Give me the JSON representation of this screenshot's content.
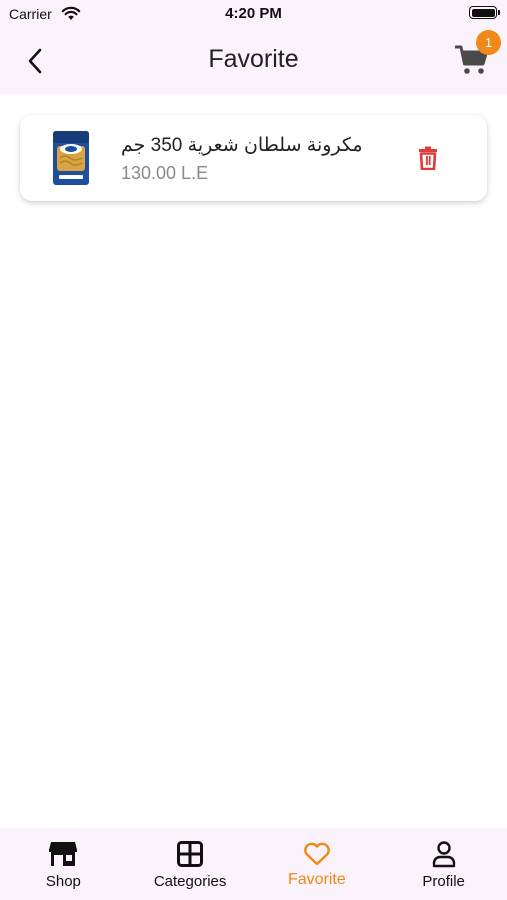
{
  "status_bar": {
    "carrier": "Carrier",
    "time": "4:20 PM"
  },
  "header": {
    "title": "Favorite",
    "cart_badge_count": "1"
  },
  "favorites": [
    {
      "name": "مكرونة سلطان شعرية 350 جم",
      "price": "130.00 L.E"
    }
  ],
  "bottom_nav": {
    "items": [
      {
        "label": "Shop",
        "icon": "shop-icon"
      },
      {
        "label": "Categories",
        "icon": "categories-icon"
      },
      {
        "label": "Favorite",
        "icon": "heart-icon",
        "active": true
      },
      {
        "label": "Profile",
        "icon": "profile-icon"
      }
    ]
  },
  "colors": {
    "accent": "#f0891a",
    "delete": "#e03b3b",
    "bar_background": "#fbf3fb"
  }
}
